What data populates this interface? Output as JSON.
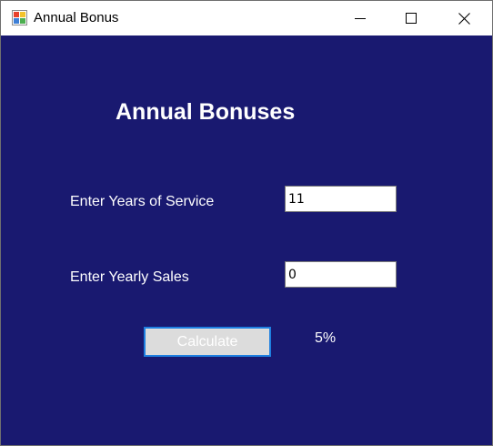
{
  "window": {
    "title": "Annual Bonus",
    "icon": "windows-forms-app-icon",
    "controls": [
      "minimize-icon",
      "maximize-icon",
      "close-icon"
    ]
  },
  "form": {
    "heading": "Annual Bonuses",
    "years_label": "Enter Years of Service",
    "years_value": "11",
    "sales_label": "Enter Yearly Sales",
    "sales_value": "0",
    "calculate_label": "Calculate",
    "result_text": "5%"
  },
  "colors": {
    "form_background": "#191970",
    "text": "#ffffff",
    "button_border_focus": "#1e7fe0",
    "button_face": "#dcdcdc"
  }
}
